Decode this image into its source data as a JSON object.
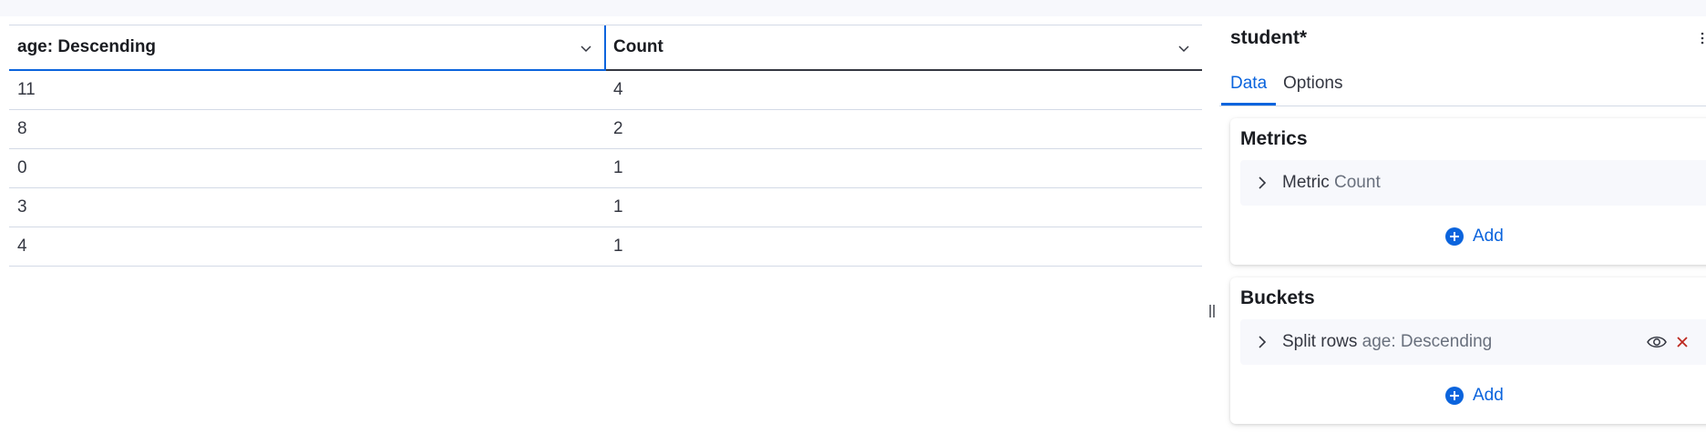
{
  "table": {
    "columns": [
      "age: Descending",
      "Count"
    ],
    "rows": [
      [
        "11",
        "4"
      ],
      [
        "8",
        "2"
      ],
      [
        "0",
        "1"
      ],
      [
        "3",
        "1"
      ],
      [
        "4",
        "1"
      ]
    ]
  },
  "panel": {
    "title": "student*",
    "tabs": [
      "Data",
      "Options"
    ],
    "active_tab": "Data",
    "metrics": {
      "title": "Metrics",
      "item_prefix": "Metric",
      "item_value": "Count",
      "add_label": "Add"
    },
    "buckets": {
      "title": "Buckets",
      "item_prefix": "Split rows",
      "item_value": "age: Descending",
      "add_label": "Add"
    }
  },
  "colors": {
    "accent": "#0b64dd",
    "danger": "#bd271e",
    "text": "#343741",
    "muted": "#69707d",
    "border": "#d3dae6"
  }
}
